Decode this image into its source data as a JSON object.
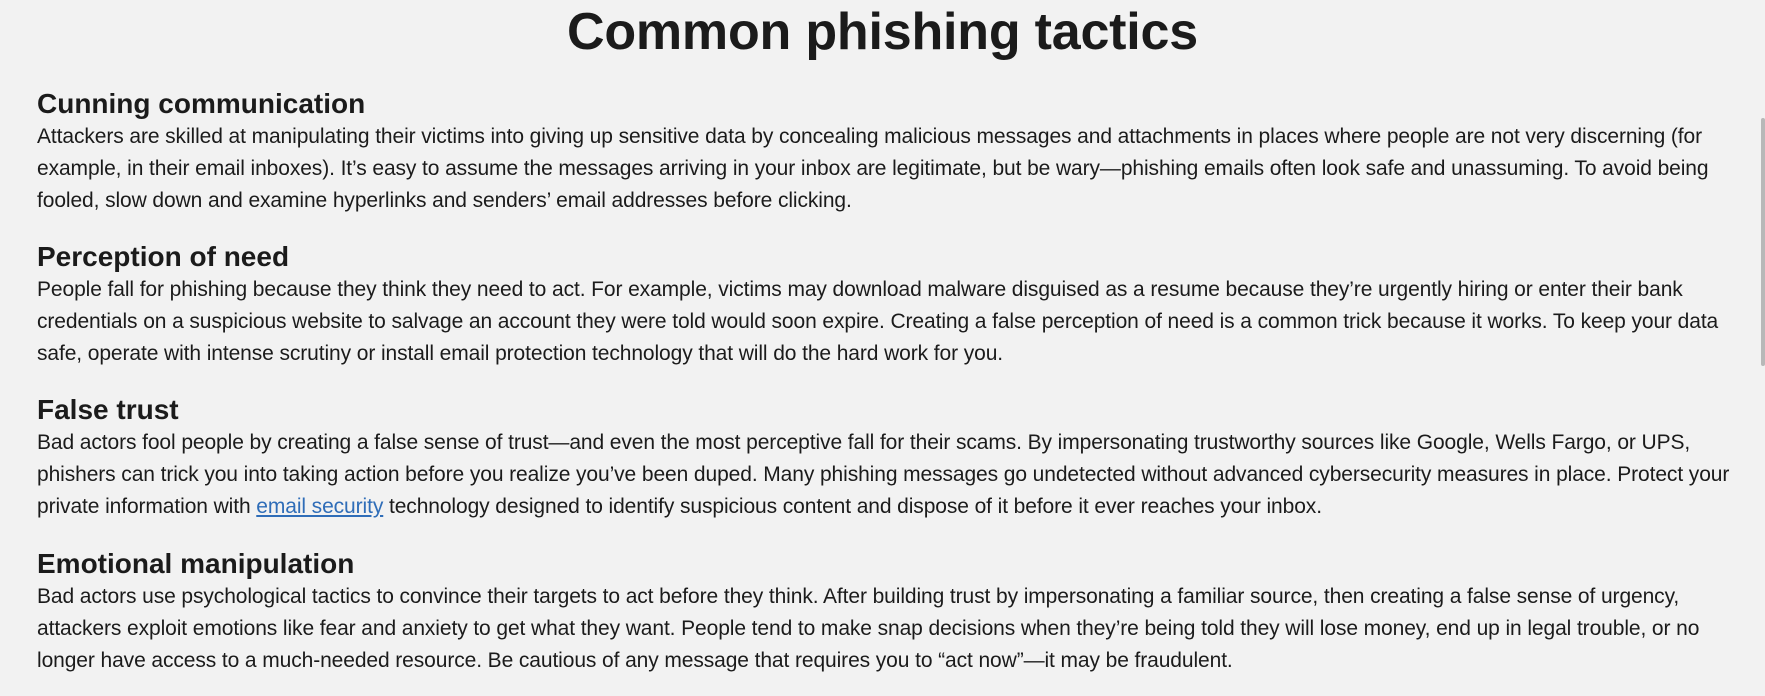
{
  "title": "Common phishing tactics",
  "sections": [
    {
      "heading": "Cunning communication",
      "body": "Attackers are skilled at manipulating their victims into giving up sensitive data by concealing malicious messages and attachments in places where people are not very discerning (for example, in their email inboxes). It’s easy to assume the messages arriving in your inbox are legitimate, but be wary—phishing emails often look safe and unassuming. To avoid being fooled, slow down and examine hyperlinks and senders’ email addresses before clicking."
    },
    {
      "heading": "Perception of need",
      "body": "People fall for phishing because they think they need to act. For example, victims may download malware disguised as a resume because they’re urgently hiring or enter their bank credentials on a suspicious website to salvage an account they were told would soon expire. Creating a false perception of need is a common trick because it works. To keep your data safe, operate with intense scrutiny or install email protection technology that will do the hard work for you."
    },
    {
      "heading": "False trust",
      "body_before_link": "Bad actors fool people by creating a false sense of trust—and even the most perceptive fall for their scams. By impersonating trustworthy sources like Google, Wells Fargo, or UPS, phishers can trick you into taking action before you realize you’ve been duped. Many phishing messages go undetected without advanced cybersecurity measures in place. Protect your private information with ",
      "link_text": "email security",
      "body_after_link": " technology designed to identify suspicious content and dispose of it before it ever reaches your inbox."
    },
    {
      "heading": "Emotional manipulation",
      "body": "Bad actors use psychological tactics to convince their targets to act before they think. After building trust by impersonating a familiar source, then creating a false sense of urgency, attackers exploit emotions like fear and anxiety to get what they want. People tend to make snap decisions when they’re being told they will lose money, end up in legal trouble, or no longer have access to a much-needed resource. Be cautious of any message that requires you to “act now”—it may be fraudulent."
    }
  ],
  "colors": {
    "background": "#f2f2f2",
    "text": "#1b1b1b",
    "link": "#2f6db8"
  }
}
